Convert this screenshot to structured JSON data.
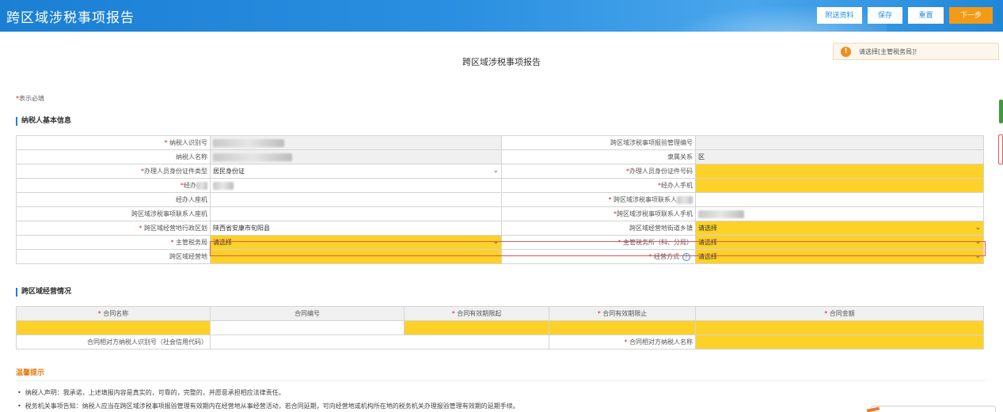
{
  "header": {
    "title": "跨区域涉税事项报告",
    "buttons": {
      "attach": "附送资料",
      "save": "保存",
      "reset": "重置",
      "next": "下一步"
    }
  },
  "toast": {
    "icon": "warning-icon",
    "message": "请选择[主管税务局]!"
  },
  "form_title": "跨区域涉税事项报告",
  "required_note": {
    "star": "*",
    "text": "表示必填"
  },
  "basic_section": {
    "title": "纳税人基本信息",
    "labels": {
      "taxpayer_id": "纳税人识别号",
      "management_no": "跨区域涉税事项报验管理编号",
      "taxpayer_name": "纳税人名称",
      "affiliation": "隶属关系",
      "id_type": "办理人员身份证件类型",
      "id_number": "办理人员身份证件号码",
      "agent_prefix": "经办",
      "agent_phone": "经办人手机",
      "agent_landline": "经办人座机",
      "contact_prefix": "跨区域涉税事项联系人",
      "contact_landline": "跨区域涉税事项联系人座机",
      "contact_mobile": "跨区域涉税事项联系人手机",
      "district": "跨区域经营地行政区划",
      "street": "跨区域经营地街道乡镇",
      "tax_bureau": "主管税务局",
      "tax_office": "主管税务所（科、分局）",
      "location": "跨区域经营地",
      "operation_mode": "经营方式"
    },
    "values": {
      "affiliation": "区",
      "id_type": "居民身份证",
      "district": "陕西省安康市旬阳县",
      "placeholder": "请选择"
    }
  },
  "ops_section": {
    "title": "跨区域经营情况",
    "headers": {
      "contract_name": "合同名称",
      "contract_no": "合同编号",
      "valid_from": "合同有效期限起",
      "valid_to": "合同有效期限止",
      "amount": "合同金额"
    },
    "counterparty_id": "合同相对方纳税人识别号（社会信用代码）",
    "counterparty_name": "合同相对方纳税人名称"
  },
  "tips": {
    "title": "温馨提示",
    "items": [
      "纳税人声明：我承诺，上述填报内容是真实的，可靠的，完整的，并愿意承担相应法律责任。",
      "税务机关事项告知：纳税人应当在跨区域涉税事项报验管理有效期内在经营地从事经营活动，若合同延期，可向经营地或机构所在地的税务机关办理报验管理有效期的延期手续。"
    ]
  }
}
